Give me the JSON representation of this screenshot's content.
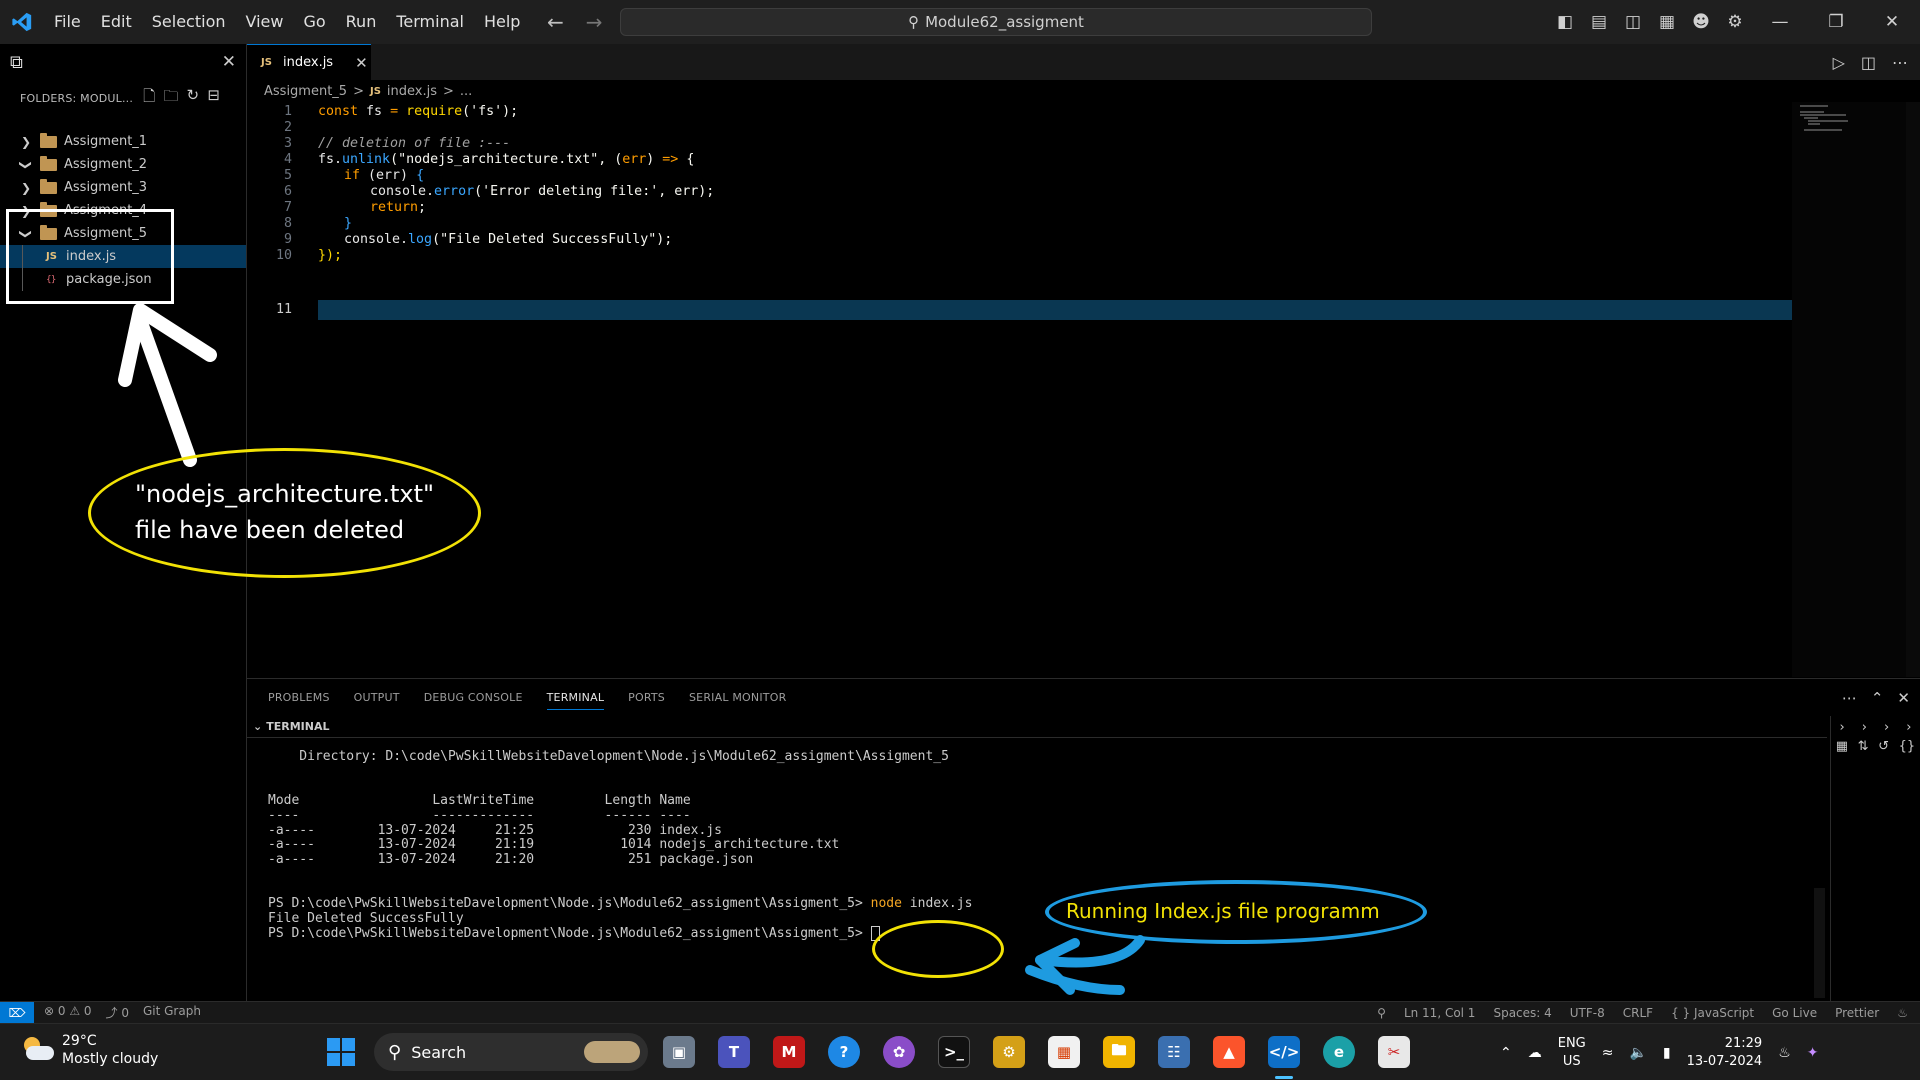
{
  "titlebar": {
    "menu": [
      "File",
      "Edit",
      "Selection",
      "View",
      "Go",
      "Run",
      "Terminal",
      "Help"
    ],
    "search_text": "Module62_assigment",
    "back_icon": "arrow-left-icon",
    "forward_icon": "arrow-right-icon"
  },
  "sidebar": {
    "folders_header": "FOLDERS: MODUL...",
    "items": [
      {
        "label": "Assigment_1",
        "expanded": false
      },
      {
        "label": "Assigment_2",
        "expanded": true
      },
      {
        "label": "Assigment_3",
        "expanded": false
      },
      {
        "label": "Assigment_4",
        "expanded": false
      },
      {
        "label": "Assigment_5",
        "expanded": true
      }
    ],
    "files": [
      {
        "badge": "JS",
        "label": "index.js",
        "selected": true
      },
      {
        "badge": "{}",
        "label": "package.json",
        "selected": false
      }
    ]
  },
  "editor": {
    "tab_badge": "JS",
    "tab_label": "index.js",
    "breadcrumb": [
      "Assigment_5",
      ">",
      "JS",
      "index.js",
      ">",
      "..."
    ],
    "line_numbers": [
      "1",
      "2",
      "3",
      "4",
      "5",
      "6",
      "7",
      "8",
      "9",
      "10",
      "11"
    ],
    "code": {
      "l1a": "const",
      "l1b": " fs ",
      "l1c": "=",
      "l1d": " require",
      "l1e": "('fs');",
      "l3": "// deletion of file :---",
      "l4a": "fs.",
      "l4b": "unlink",
      "l4c": "(\"nodejs_architecture.txt\", (",
      "l4d": "err",
      "l4e": ") ",
      "l4f": "=>",
      "l4g": " {",
      "l5a": "if",
      "l5b": " (err) ",
      "l5c": "{",
      "l6a": "console.",
      "l6b": "error",
      "l6c": "('Error deleting file:', err);",
      "l7a": "return",
      "l7b": ";",
      "l8": "}",
      "l9a": "console.",
      "l9b": "log",
      "l9c": "(\"File Deleted SuccessFully\");",
      "l10": "});"
    }
  },
  "panel": {
    "tabs": [
      "PROBLEMS",
      "OUTPUT",
      "DEBUG CONSOLE",
      "TERMINAL",
      "PORTS",
      "SERIAL MONITOR"
    ],
    "terminal_header": "TERMINAL",
    "terminal": {
      "directory": "    Directory: D:\\code\\PwSkillWebsiteDavelopment\\Node.js\\Module62_assigment\\Assigment_5",
      "head": "Mode                 LastWriteTime         Length Name",
      "dashes": "----                 -------------         ------ ----",
      "row1": "-a----        13-07-2024     21:25            230 index.js",
      "row2": "-a----        13-07-2024     21:19           1014 nodejs_architecture.txt",
      "row3": "-a----        13-07-2024     21:20            251 package.json",
      "prompt": "PS D:\\code\\PwSkillWebsiteDavelopment\\Node.js\\Module62_assigment\\Assigment_5> ",
      "cmd_node": "node",
      "cmd_rest": " index.js",
      "output": "File Deleted SuccessFully",
      "prompt2": "PS D:\\code\\PwSkillWebsiteDavelopment\\Node.js\\Module62_assigment\\Assigment_5> "
    }
  },
  "statusbar": {
    "left": [
      "⊗ 0 ⚠ 0",
      "⤴ 0",
      "Git Graph"
    ],
    "right": [
      "Ln 11, Col 1",
      "Spaces: 4",
      "UTF-8",
      "CRLF",
      "{ } JavaScript",
      "Go Live",
      "Prettier"
    ]
  },
  "taskbar": {
    "temp": "29°C",
    "weather": "Mostly cloudy",
    "search": "Search",
    "lang1": "ENG",
    "lang2": "US",
    "time": "21:29",
    "date": "13-07-2024"
  },
  "annotations": {
    "note_line1": "\"nodejs_architecture.txt\"",
    "note_line2": "file have been deleted",
    "running_note": "Running Index.js file programm"
  },
  "colors": {
    "accent": "#0078d4",
    "annotation_yellow": "#f2e205",
    "annotation_blue": "#1e9be0"
  }
}
